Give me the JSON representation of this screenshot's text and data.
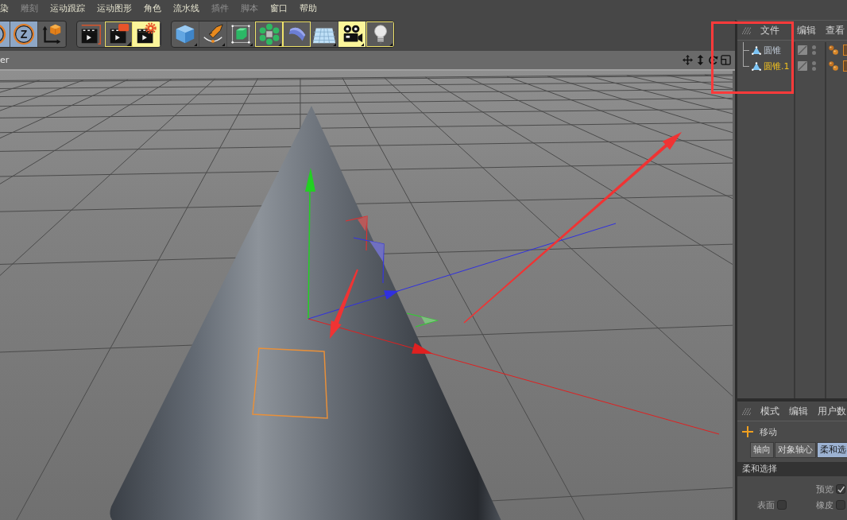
{
  "menu": [
    {
      "label": "染",
      "dimmed": false
    },
    {
      "label": "雕刻",
      "dimmed": true
    },
    {
      "label": "运动跟踪",
      "dimmed": false
    },
    {
      "label": "运动图形",
      "dimmed": false
    },
    {
      "label": "角色",
      "dimmed": false
    },
    {
      "label": "流水线",
      "dimmed": false
    },
    {
      "label": "插件",
      "dimmed": true
    },
    {
      "label": "脚本",
      "dimmed": true
    },
    {
      "label": "窗口",
      "dimmed": false
    },
    {
      "label": "帮助",
      "dimmed": false
    }
  ],
  "toolbar": {
    "groups": [
      {
        "items": [
          {
            "kind": "axis-partial",
            "on": true
          },
          {
            "kind": "axis",
            "label": "Z",
            "on": true
          },
          {
            "kind": "coordinates",
            "on": false
          }
        ]
      },
      {
        "items": [
          {
            "kind": "render-view"
          },
          {
            "kind": "render-picture"
          },
          {
            "kind": "render-settings"
          }
        ]
      },
      {
        "items": [
          {
            "kind": "cube"
          },
          {
            "kind": "pen"
          },
          {
            "kind": "subdivision"
          },
          {
            "kind": "cloner"
          },
          {
            "kind": "bend"
          },
          {
            "kind": "floor"
          },
          {
            "kind": "camera"
          },
          {
            "kind": "light"
          }
        ]
      }
    ]
  },
  "viewport": {
    "header_text": "er"
  },
  "object_manager": {
    "menu": [
      "文件",
      "编辑",
      "查看"
    ],
    "objects": [
      {
        "name": "圆锥",
        "selected": false
      },
      {
        "name": "圆锥.1",
        "selected": true
      }
    ]
  },
  "attribute_manager": {
    "menu": [
      "模式",
      "编辑",
      "用户数"
    ],
    "tool": "移动",
    "tabs": [
      {
        "label": "轴向",
        "selected": false
      },
      {
        "label": "对象轴心",
        "selected": false
      },
      {
        "label": "柔和选",
        "selected": true
      }
    ],
    "section": "柔和选择",
    "options": [
      {
        "label": "预览",
        "checked": true
      },
      {
        "label": "表面",
        "checked": false
      },
      {
        "label": "橡皮",
        "checked": false
      }
    ]
  }
}
